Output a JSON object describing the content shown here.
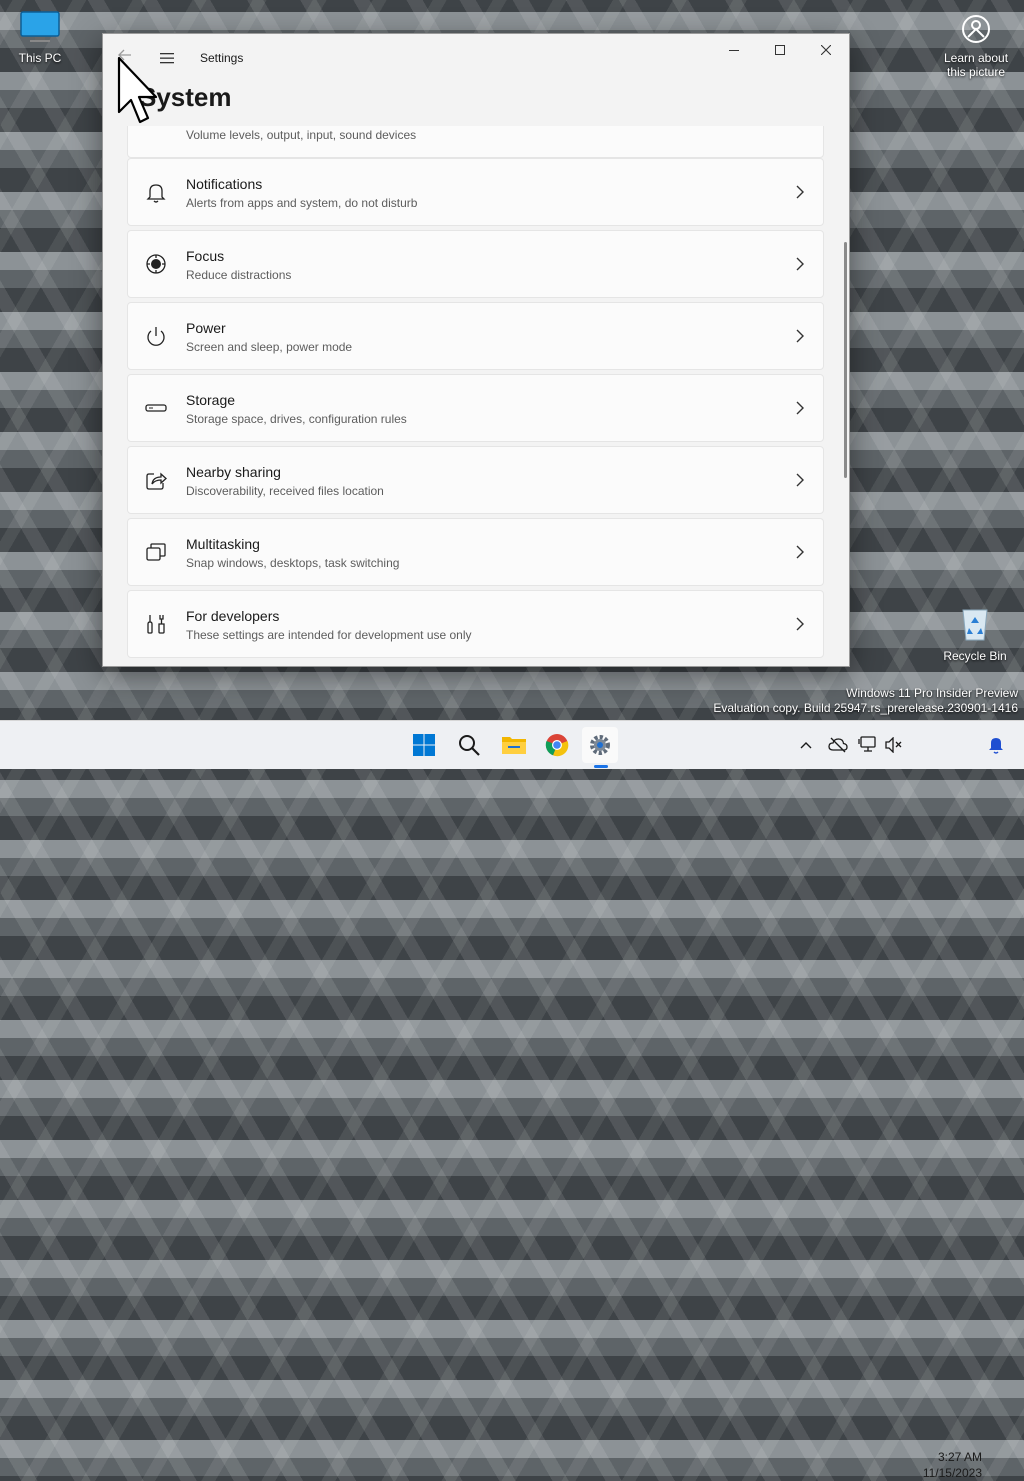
{
  "desktop": {
    "this_pc_label": "This PC",
    "learn_label_1": "Learn about",
    "learn_label_2": "this picture",
    "recycle_label": "Recycle Bin",
    "watermark_line1": "Windows 11 Pro Insider Preview",
    "watermark_line2": "Evaluation copy. Build 25947.rs_prerelease.230901-1416"
  },
  "window": {
    "app_title": "Settings",
    "page_title": "System",
    "partial_item_sub": "Volume levels, output, input, sound devices",
    "items": [
      {
        "title": "Notifications",
        "subtitle": "Alerts from apps and system, do not disturb",
        "icon": "bell-icon"
      },
      {
        "title": "Focus",
        "subtitle": "Reduce distractions",
        "icon": "focus-icon"
      },
      {
        "title": "Power",
        "subtitle": "Screen and sleep, power mode",
        "icon": "power-icon"
      },
      {
        "title": "Storage",
        "subtitle": "Storage space, drives, configuration rules",
        "icon": "storage-icon"
      },
      {
        "title": "Nearby sharing",
        "subtitle": "Discoverability, received files location",
        "icon": "share-icon"
      },
      {
        "title": "Multitasking",
        "subtitle": "Snap windows, desktops, task switching",
        "icon": "multitasking-icon"
      },
      {
        "title": "For developers",
        "subtitle": "These settings are intended for development use only",
        "icon": "developer-tools-icon"
      }
    ]
  },
  "taskbar": {
    "apps": [
      "start-icon",
      "search-icon",
      "file-explorer-icon",
      "chrome-icon",
      "settings-icon"
    ],
    "time": "3:27 AM",
    "date": "11/15/2023"
  },
  "colors": {
    "accent": "#0067c0",
    "window_bg": "#f3f3f3",
    "card_bg": "#fbfbfb"
  }
}
